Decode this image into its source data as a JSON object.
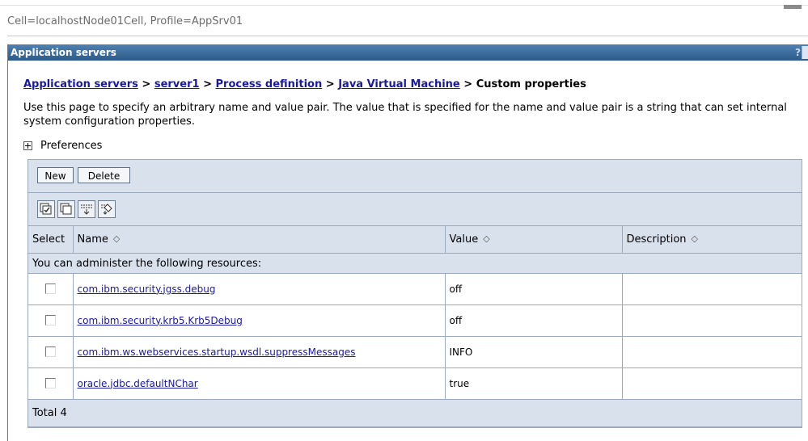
{
  "header": {
    "cell_profile": "Cell=localhostNode01Cell, Profile=AppSrv01"
  },
  "portlet": {
    "title": "Application servers",
    "help_label": "?"
  },
  "breadcrumb": {
    "items": [
      "Application servers",
      "server1",
      "Process definition",
      "Java Virtual Machine"
    ],
    "separator": ">",
    "current": "Custom properties"
  },
  "description": "Use this page to specify an arbitrary name and value pair. The value that is specified for the name and value pair is a string that can set internal system configuration properties.",
  "preferences_label": "Preferences",
  "toolbar": {
    "new_label": "New",
    "delete_label": "Delete"
  },
  "icons": [
    "select-all-icon",
    "deselect-all-icon",
    "show-filter-icon",
    "clear-filter-icon"
  ],
  "table": {
    "columns": [
      "Select",
      "Name",
      "Value",
      "Description"
    ],
    "sort_glyph": "◇",
    "info_text": "You can administer the following resources:",
    "rows": [
      {
        "name": "com.ibm.security.jgss.debug",
        "value": "off",
        "description": ""
      },
      {
        "name": "com.ibm.security.krb5.Krb5Debug",
        "value": "off",
        "description": ""
      },
      {
        "name": "com.ibm.ws.webservices.startup.wsdl.suppressMessages",
        "value": "INFO",
        "description": ""
      },
      {
        "name": "oracle.jdbc.defaultNChar",
        "value": "true",
        "description": ""
      }
    ],
    "total_label": "Total 4"
  },
  "colors": {
    "title_bar": "#3b6a9a",
    "link": "#1a1aa0",
    "grid_bg": "#d8e1ec"
  }
}
